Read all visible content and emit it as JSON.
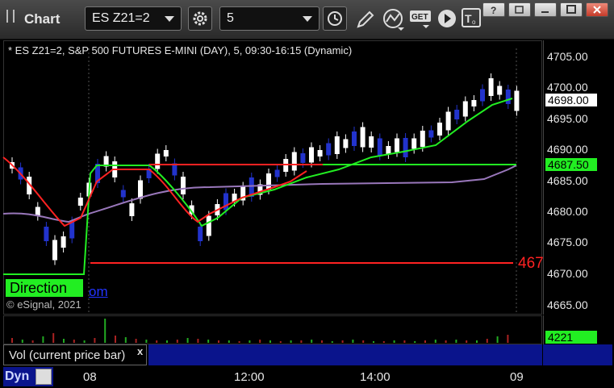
{
  "app": {
    "title": "Chart"
  },
  "toolbar": {
    "symbol": "ES Z21=2",
    "interval": "5"
  },
  "chart": {
    "header": "* ES Z21=2, S&P 500 FUTURES E-MINI (DAY), 5, 09:30-16:15 (Dynamic)",
    "price_ticks": [
      "4705.00",
      "4700.00",
      "4695.00",
      "4690.00",
      "4685.00",
      "4680.00",
      "4675.00",
      "4670.00",
      "4665.00"
    ],
    "last_price": "4698.00",
    "line_price": "4687.50",
    "red_annotation": "467",
    "direction_label": "Direction",
    "link_fragment": "om",
    "copyright": "© eSignal, 2021"
  },
  "volume": {
    "label": "Vol (current price bar)",
    "value": "4221",
    "close_glyph": "x"
  },
  "time_axis": {
    "labels": [
      "08",
      "12:00",
      "14:00",
      "09"
    ]
  },
  "status": {
    "mode": "Dyn"
  },
  "colors": {
    "background": "#000000",
    "up_candle": "#ffffff",
    "down_candle": "#2233cc",
    "green_line": "#22ee22",
    "red_line": "#ff2222",
    "purple_line": "#9977bb",
    "accent_blue": "#0a148c"
  }
}
